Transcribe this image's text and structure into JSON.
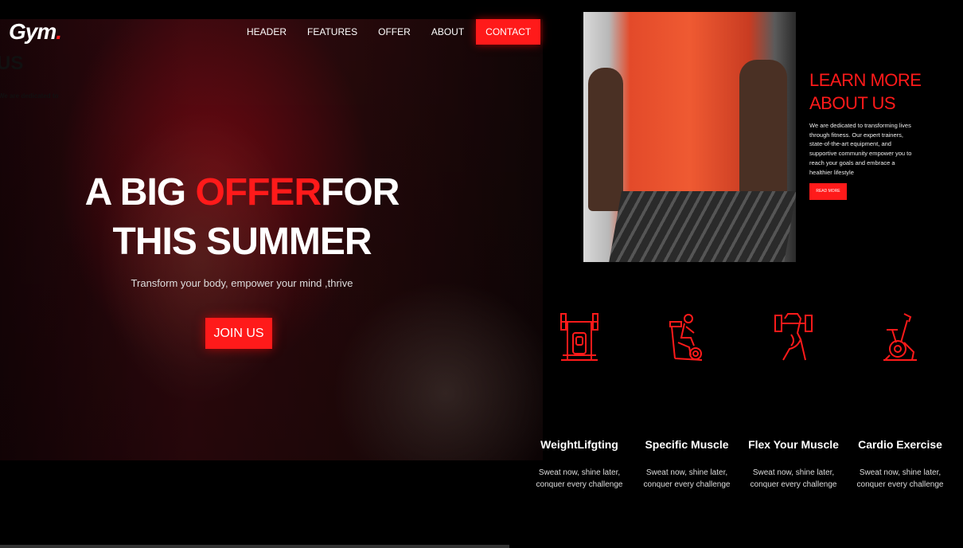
{
  "brand": {
    "logo_text": "Gym",
    "logo_dot": "."
  },
  "nav": {
    "items": [
      "HEADER",
      "FEATURES",
      "OFFER",
      "ABOUT"
    ],
    "contact": "CONTACT"
  },
  "hero": {
    "title_a": "A BIG ",
    "title_highlight": "OFFER",
    "title_b": "FOR",
    "title_line2": "THIS SUMMER",
    "subtitle": "Transform your body, empower your mind ,thrive",
    "cta": "JOIN US"
  },
  "background_fragments": {
    "heading": "US",
    "line": "We are dedicated to"
  },
  "about": {
    "title": "LEARN MORE ABOUT US",
    "text": "We are dedicated to transforming lives through fitness. Our expert trainers, state-of-the-art equipment, and supportive community empower you to reach your goals and embrace a healthier lifestyle",
    "button": "READ MORE"
  },
  "features": [
    {
      "icon": "bench-press-icon",
      "title": "WeightLifgting",
      "desc": "Sweat now, shine later, conquer every challenge"
    },
    {
      "icon": "stationary-bike-icon",
      "title": "Specific Muscle",
      "desc": "Sweat now, shine later, conquer every challenge"
    },
    {
      "icon": "dumbbell-arm-icon",
      "title": "Flex Your Muscle",
      "desc": "Sweat now, shine later, conquer every challenge"
    },
    {
      "icon": "exercise-bike-icon",
      "title": "Cardio Exercise",
      "desc": "Sweat now, shine later, conquer every challenge"
    }
  ],
  "colors": {
    "accent": "#ff1a1a",
    "background": "#000000",
    "text": "#ffffff"
  }
}
